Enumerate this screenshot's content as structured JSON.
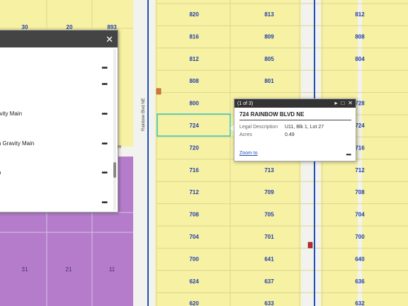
{
  "map": {
    "road_label": "Rainbow Blvd NE",
    "top_left_parcels": [
      "30",
      "20",
      "893"
    ],
    "col_a": [
      "820",
      "816",
      "812",
      "808",
      "800",
      "724",
      "720",
      "716",
      "712",
      "708",
      "704",
      "700",
      "624",
      "620"
    ],
    "col_b": [
      "813",
      "809",
      "805",
      "801",
      "",
      "",
      "",
      "713",
      "709",
      "705",
      "701",
      "641",
      "637",
      "633"
    ],
    "col_c": [
      "812",
      "808",
      "804",
      "",
      "728",
      "724",
      "716",
      "712",
      "708",
      "704",
      "700",
      "640",
      "636",
      "632"
    ],
    "block_parcels": [
      "31",
      "21",
      "11"
    ],
    "colors": {
      "parcel_fill": "#f7f1a4",
      "parcel_line": "#d8d2a0",
      "highlight": "#35c9c6",
      "purple": "#b47cca",
      "road": "#eeeeee",
      "water_line": "#1f4fb4"
    },
    "icons": [
      "manhole-marker",
      "hydrant-marker"
    ]
  },
  "panel": {
    "close_label": "✕",
    "more_label": "•••",
    "rows": [
      {
        "label": ""
      },
      {
        "label": ""
      },
      {
        "label": "avity Main"
      },
      {
        "label": "in Gravity Main"
      },
      {
        "label": "in"
      },
      {
        "label": ""
      }
    ],
    "partial_label": "w"
  },
  "popup": {
    "page_label": "(1 of 3)",
    "next_icon": "▸",
    "max_icon": "□",
    "close_icon": "✕",
    "title": "724 RAINBOW BLVD NE",
    "fields": [
      {
        "key": "Legal Description",
        "value": "U11, Blk 1, Lot 27"
      },
      {
        "key": "Acres",
        "value": "0.49"
      }
    ],
    "zoom_label": "Zoom to",
    "more_label": "•••"
  }
}
